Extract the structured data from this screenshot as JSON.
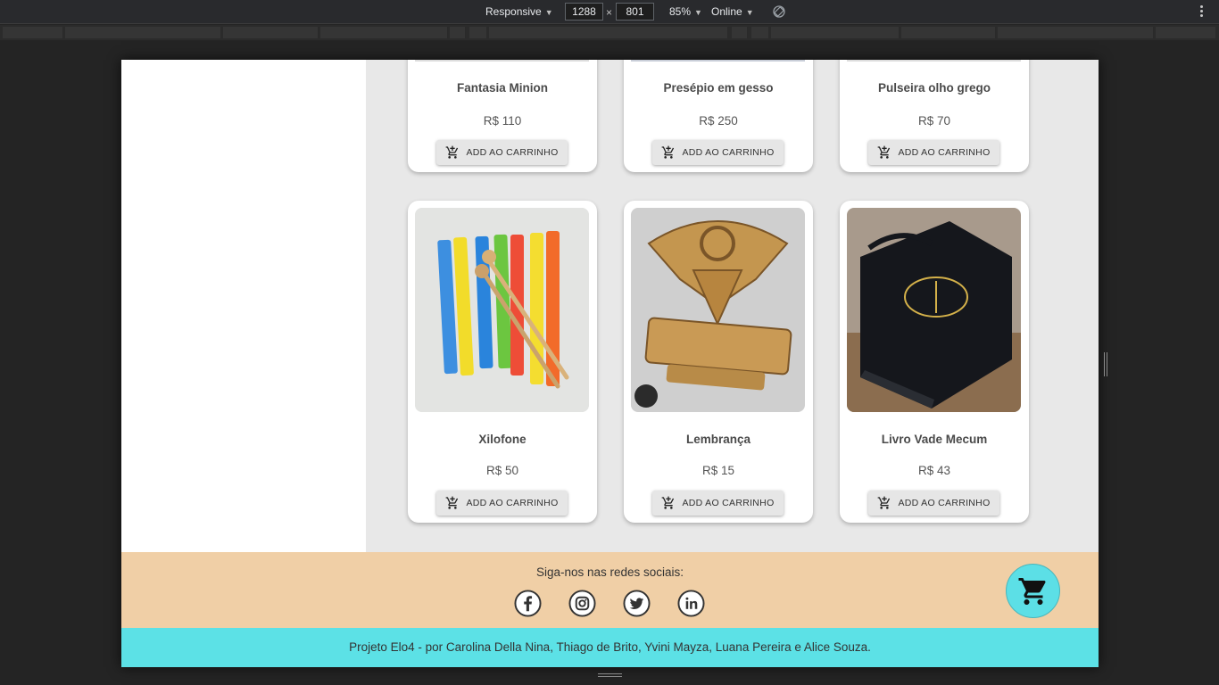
{
  "devtools": {
    "device": "Responsive",
    "width": "1288",
    "height": "801",
    "times": "×",
    "zoom": "85%",
    "network": "Online"
  },
  "products_row1": [
    {
      "name": "Fantasia Minion",
      "price": "R$ 110",
      "button": "ADD AO CARRINHO"
    },
    {
      "name": "Presépio em gesso",
      "price": "R$ 250",
      "button": "ADD AO CARRINHO"
    },
    {
      "name": "Pulseira olho grego",
      "price": "R$ 70",
      "button": "ADD AO CARRINHO"
    }
  ],
  "products_row2": [
    {
      "name": "Xilofone",
      "price": "R$ 50",
      "button": "ADD AO CARRINHO"
    },
    {
      "name": "Lembrança",
      "price": "R$ 15",
      "button": "ADD AO CARRINHO"
    },
    {
      "name": "Livro Vade Mecum",
      "price": "R$ 43",
      "button": "ADD AO CARRINHO"
    }
  ],
  "footer": {
    "social_title": "Siga-nos nas redes sociais:",
    "social_icons": [
      "facebook-icon",
      "instagram-icon",
      "twitter-icon",
      "linkedin-icon"
    ],
    "credits": "Projeto Elo4 - por Carolina Della Nina, Thiago de Brito, Yvini Mayza, Luana Pereira e Alice Souza."
  },
  "colors": {
    "footer_social_bg": "#f0cfa6",
    "footer_credits_bg": "#5ce1e6",
    "content_bg": "#e8e8e8"
  }
}
